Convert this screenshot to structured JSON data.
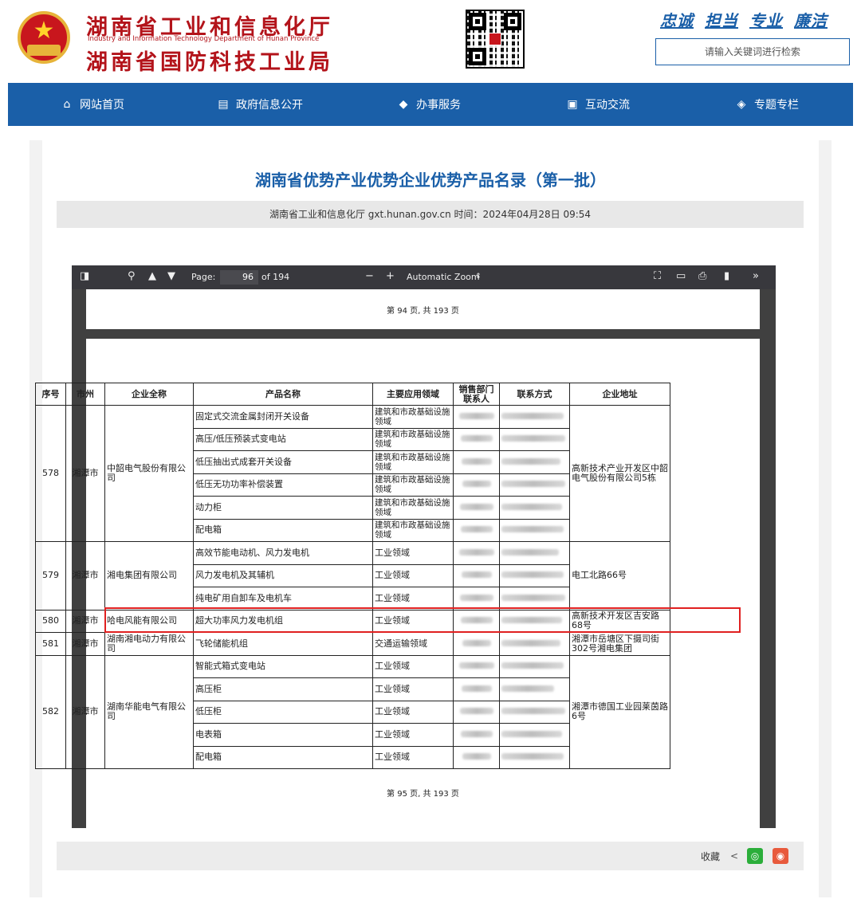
{
  "header": {
    "title_line1": "湖南省工业和信息化厅",
    "title_en": "Industry and Information Technology Department of Hunan Province",
    "title_line2": "湖南省国防科技工业局",
    "slogans": [
      "忠诚",
      "担当",
      "专业",
      "廉洁"
    ],
    "search_placeholder": "请输入关键词进行检索"
  },
  "nav": [
    {
      "label": "网站首页",
      "icon": "home-icon"
    },
    {
      "label": "政府信息公开",
      "icon": "document-icon"
    },
    {
      "label": "办事服务",
      "icon": "handshake-icon"
    },
    {
      "label": "互动交流",
      "icon": "chat-icon"
    },
    {
      "label": "专题专栏",
      "icon": "layers-icon"
    }
  ],
  "article": {
    "title": "湖南省优势产业优势企业优势产品名录（第一批）",
    "meta": "湖南省工业和信息化厅 gxt.hunan.gov.cn   时间：2024年04月28日 09:54"
  },
  "viewer": {
    "page_label": "Page:",
    "page_value": "96",
    "page_total": "of 194",
    "zoom": "Automatic Zoom",
    "prev_footer": "第 94 页, 共 193 页",
    "cur_footer": "第 95 页, 共 193 页"
  },
  "table": {
    "headers": [
      "序号",
      "市州",
      "企业全称",
      "产品名称",
      "主要应用领域",
      "销售部门联系人",
      "联系方式",
      "企业地址"
    ],
    "groups": [
      {
        "no": "578",
        "city": "湘潭市",
        "company": "中韶电气股份有限公司",
        "address": "高新技术产业开发区中韶电气股份有限公司5栋",
        "products": [
          {
            "name": "固定式交流金属封闭开关设备",
            "field": "建筑和市政基础设施领域"
          },
          {
            "name": "高压/低压预装式变电站",
            "field": "建筑和市政基础设施领域"
          },
          {
            "name": "低压抽出式成套开关设备",
            "field": "建筑和市政基础设施领域"
          },
          {
            "name": "低压无功功率补偿装置",
            "field": "建筑和市政基础设施领域"
          },
          {
            "name": "动力柜",
            "field": "建筑和市政基础设施领域"
          },
          {
            "name": "配电箱",
            "field": "建筑和市政基础设施领域"
          }
        ]
      },
      {
        "no": "579",
        "city": "湘潭市",
        "company": "湘电集团有限公司",
        "address": "电工北路66号",
        "products": [
          {
            "name": "高效节能电动机、风力发电机",
            "field": "工业领域"
          },
          {
            "name": "风力发电机及其辅机",
            "field": "工业领域"
          },
          {
            "name": "纯电矿用自卸车及电机车",
            "field": "工业领域"
          }
        ]
      },
      {
        "no": "580",
        "city": "湘潭市",
        "company": "哈电风能有限公司",
        "address": "高新技术开发区吉安路68号",
        "products": [
          {
            "name": "超大功率风力发电机组",
            "field": "工业领域"
          }
        ]
      },
      {
        "no": "581",
        "city": "湘潭市",
        "company": "湖南湘电动力有限公司",
        "address": "湘潭市岳塘区下摄司街302号湘电集团",
        "products": [
          {
            "name": "飞轮储能机组",
            "field": "交通运输领域"
          }
        ]
      },
      {
        "no": "582",
        "city": "湘潭市",
        "company": "湖南华能电气有限公司",
        "address": "湘潭市德国工业园莱茵路6号",
        "products": [
          {
            "name": "智能式箱式变电站",
            "field": "工业领域"
          },
          {
            "name": "高压柜",
            "field": "工业领域"
          },
          {
            "name": "低压柜",
            "field": "工业领域"
          },
          {
            "name": "电表箱",
            "field": "工业领域"
          },
          {
            "name": "配电箱",
            "field": "工业领域"
          }
        ]
      }
    ]
  },
  "footer": {
    "collect_label": "收藏"
  }
}
